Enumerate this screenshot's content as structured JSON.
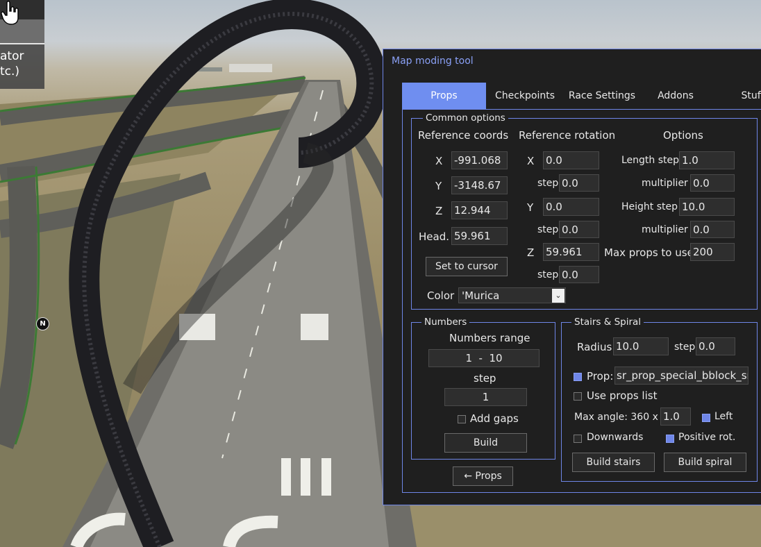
{
  "hud": {
    "line1": "ator",
    "line2": "tc.)",
    "north_marker": "N"
  },
  "panel": {
    "title": "Map moding tool",
    "tabs": [
      {
        "label": "Props",
        "active": true
      },
      {
        "label": "Checkpoints",
        "active": false
      },
      {
        "label": "Race Settings",
        "active": false
      },
      {
        "label": "Addons",
        "active": false
      },
      {
        "label": "Stuff",
        "active": false
      }
    ],
    "common": {
      "legend": "Common options",
      "ref_coords_header": "Reference coords",
      "ref_rotation_header": "Reference rotation",
      "options_header": "Options",
      "coords": {
        "x_label": "X",
        "x_value": "-991.068",
        "y_label": "Y",
        "y_value": "-3148.67",
        "z_label": "Z",
        "z_value": "12.944",
        "head_label": "Head.",
        "head_value": "59.961"
      },
      "set_to_cursor": "Set to cursor",
      "rotation": {
        "x_label": "X",
        "x_value": "0.0",
        "x_step_label": "step",
        "x_step_value": "0.0",
        "y_label": "Y",
        "y_value": "0.0",
        "y_step_label": "step",
        "y_step_value": "0.0",
        "z_label": "Z",
        "z_value": "59.961",
        "z_step_label": "step",
        "z_step_value": "0.0"
      },
      "options": {
        "length_step_label": "Length step",
        "length_step_value": "1.0",
        "length_mult_label": "multiplier",
        "length_mult_value": "0.0",
        "height_step_label": "Height step",
        "height_step_value": "10.0",
        "height_mult_label": "multiplier",
        "height_mult_value": "0.0",
        "max_props_label": "Max props to use",
        "max_props_value": "200"
      },
      "color_label": "Color",
      "color_value": "'Murica"
    },
    "numbers": {
      "legend": "Numbers",
      "range_label": "Numbers range",
      "range_value": "1  -  10",
      "step_label": "step",
      "step_value": "1",
      "add_gaps_label": "Add gaps",
      "add_gaps_checked": false,
      "build_label": "Build"
    },
    "back_button": "← Props",
    "stairs": {
      "legend": "Stairs & Spiral",
      "radius_label": "Radius",
      "radius_value": "10.0",
      "step_label": "step",
      "step_value": "0.0",
      "prop_label": "Prop:",
      "prop_checked": true,
      "prop_value": "sr_prop_special_bblock_sm",
      "use_props_list_label": "Use props list",
      "use_props_list_checked": false,
      "max_angle_label": "Max angle: 360 x",
      "max_angle_value": "1.0",
      "left_label": "Left",
      "left_checked": true,
      "downwards_label": "Downwards",
      "downwards_checked": false,
      "positive_rot_label": "Positive rot.",
      "positive_rot_checked": true,
      "build_stairs": "Build stairs",
      "build_spiral": "Build spiral"
    }
  },
  "colors": {
    "accent": "#6f86e8",
    "panel_bg": "#1f1f1f",
    "input_bg": "#2e2e2e",
    "tab_active": "#6f8ef0"
  }
}
